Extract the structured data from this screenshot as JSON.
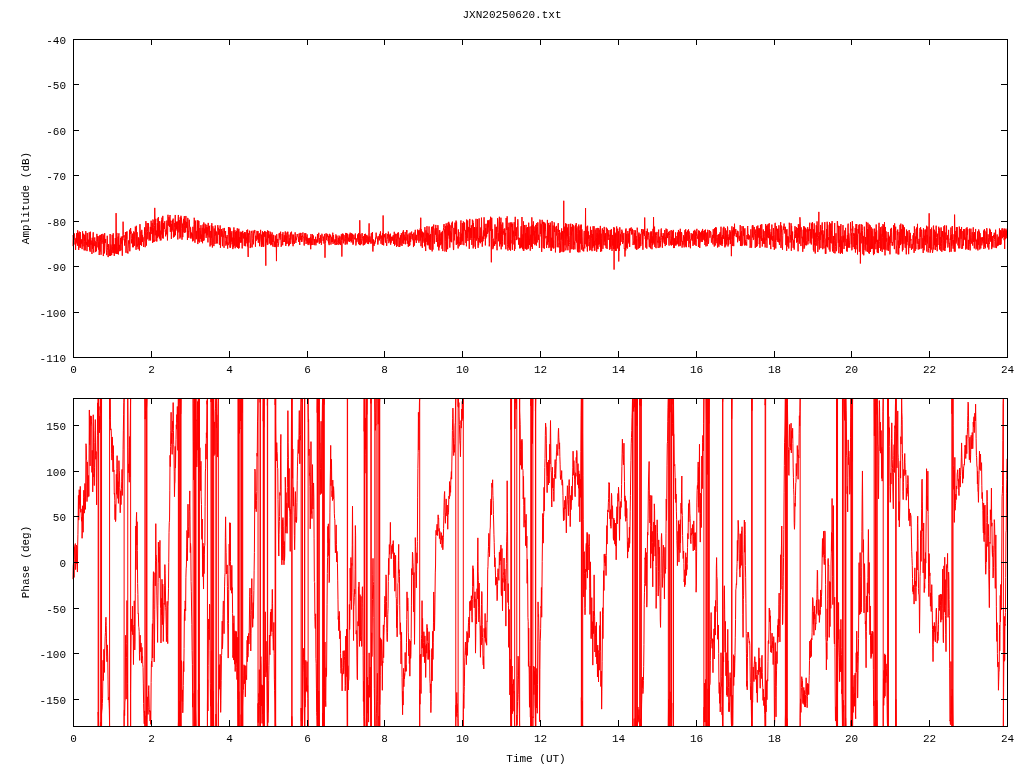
{
  "title": "JXN20250620.txt",
  "panels": [
    {
      "kind": "amplitude",
      "ylabel": "Amplitude (dB)",
      "yticks": [
        "-40",
        "-50",
        "-60",
        "-70",
        "-80",
        "-90",
        "-100",
        "-110"
      ],
      "xticks": [
        "0",
        "2",
        "4",
        "6",
        "8",
        "10",
        "12",
        "14",
        "16",
        "18",
        "20",
        "22",
        "24"
      ]
    },
    {
      "kind": "phase",
      "ylabel": "Phase (deg)",
      "yticks": [
        "150",
        "100",
        "50",
        "0",
        "-50",
        "-100",
        "-150"
      ],
      "xticks": [
        "0",
        "2",
        "4",
        "6",
        "8",
        "10",
        "12",
        "14",
        "16",
        "18",
        "20",
        "22",
        "24"
      ]
    }
  ],
  "xlabel": "Time (UT)"
}
